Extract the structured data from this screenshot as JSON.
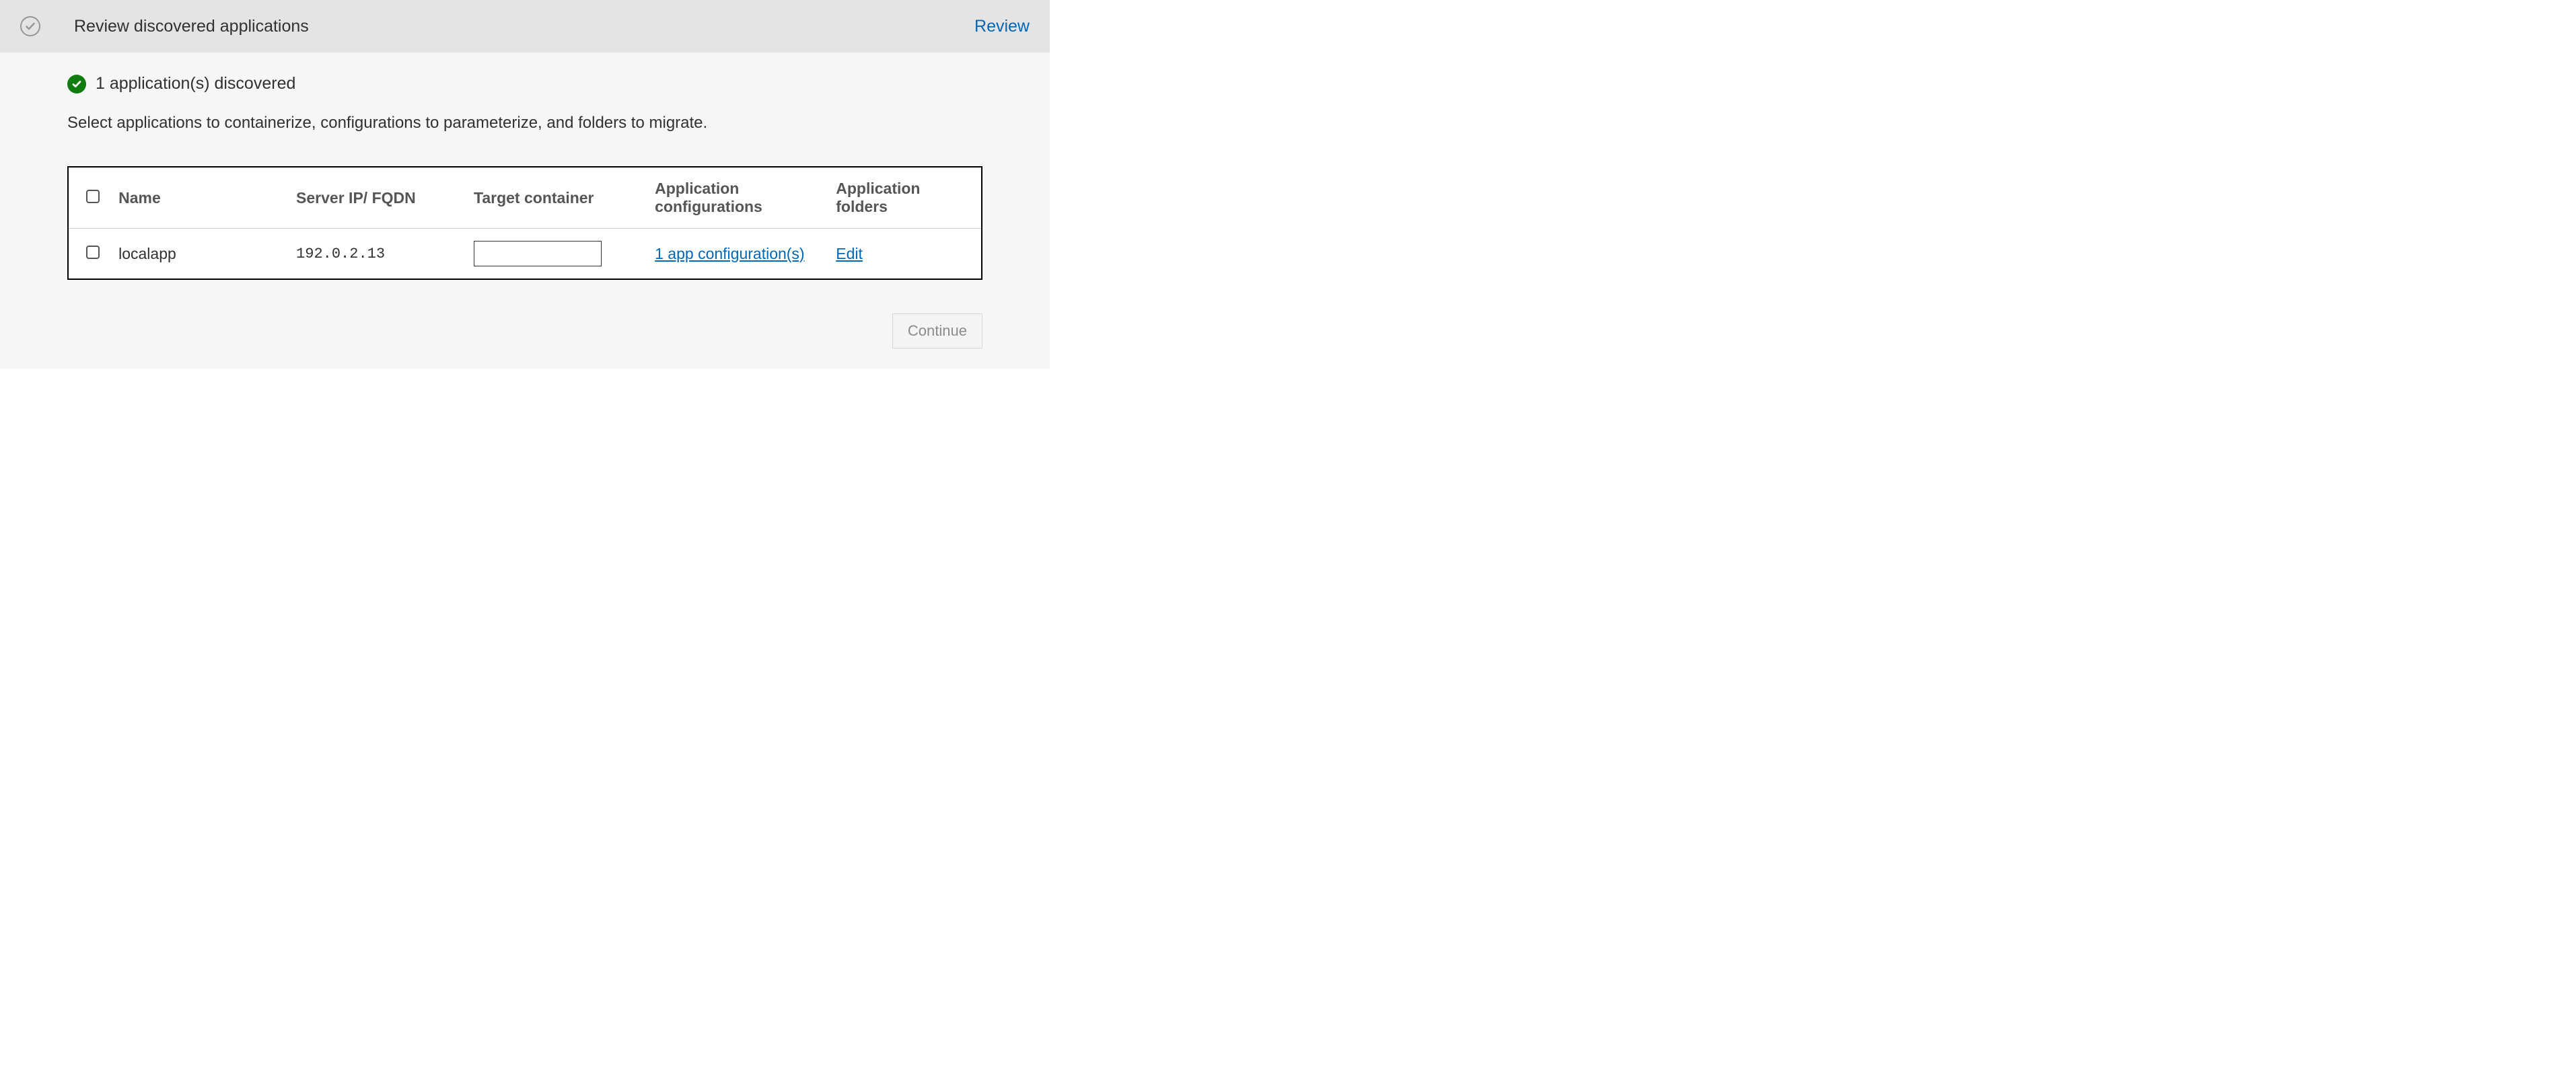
{
  "header": {
    "title": "Review discovered applications",
    "review_link": "Review"
  },
  "status": {
    "text": "1 application(s) discovered"
  },
  "instruction": "Select applications to containerize, configurations to parameterize, and folders to migrate.",
  "table": {
    "headers": {
      "name": "Name",
      "server": "Server IP/ FQDN",
      "target": "Target container",
      "config": "Application configurations",
      "folders": "Application folders"
    },
    "rows": [
      {
        "name": "localapp",
        "server": "192.0.2.13",
        "target": "",
        "config_link": "1 app configuration(s)",
        "folders_link": "Edit"
      }
    ]
  },
  "buttons": {
    "continue": "Continue"
  }
}
